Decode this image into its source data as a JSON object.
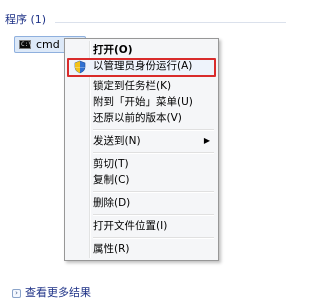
{
  "panel": {
    "section_title": "程序 (1)",
    "result": {
      "label": "cmd",
      "icon": "cmd-console-icon"
    },
    "see_more": {
      "label": "查看更多结果",
      "icon": "chevron-right-icon"
    }
  },
  "context_menu": {
    "items": [
      {
        "label": "打开(O)",
        "bold": true
      },
      {
        "label": "以管理员身份运行(A)",
        "icon": "uac-shield-icon",
        "highlighted": true,
        "highlight_color": "#d92b2b"
      },
      {
        "label": "锁定到任务栏(K)"
      },
      {
        "label": "附到「开始」菜单(U)"
      },
      {
        "label": "还原以前的版本(V)"
      },
      {
        "label": "发送到(N)",
        "submenu": true
      },
      {
        "label": "剪切(T)"
      },
      {
        "label": "复制(C)"
      },
      {
        "label": "删除(D)"
      },
      {
        "label": "打开文件位置(I)"
      },
      {
        "label": "属性(R)"
      }
    ]
  }
}
